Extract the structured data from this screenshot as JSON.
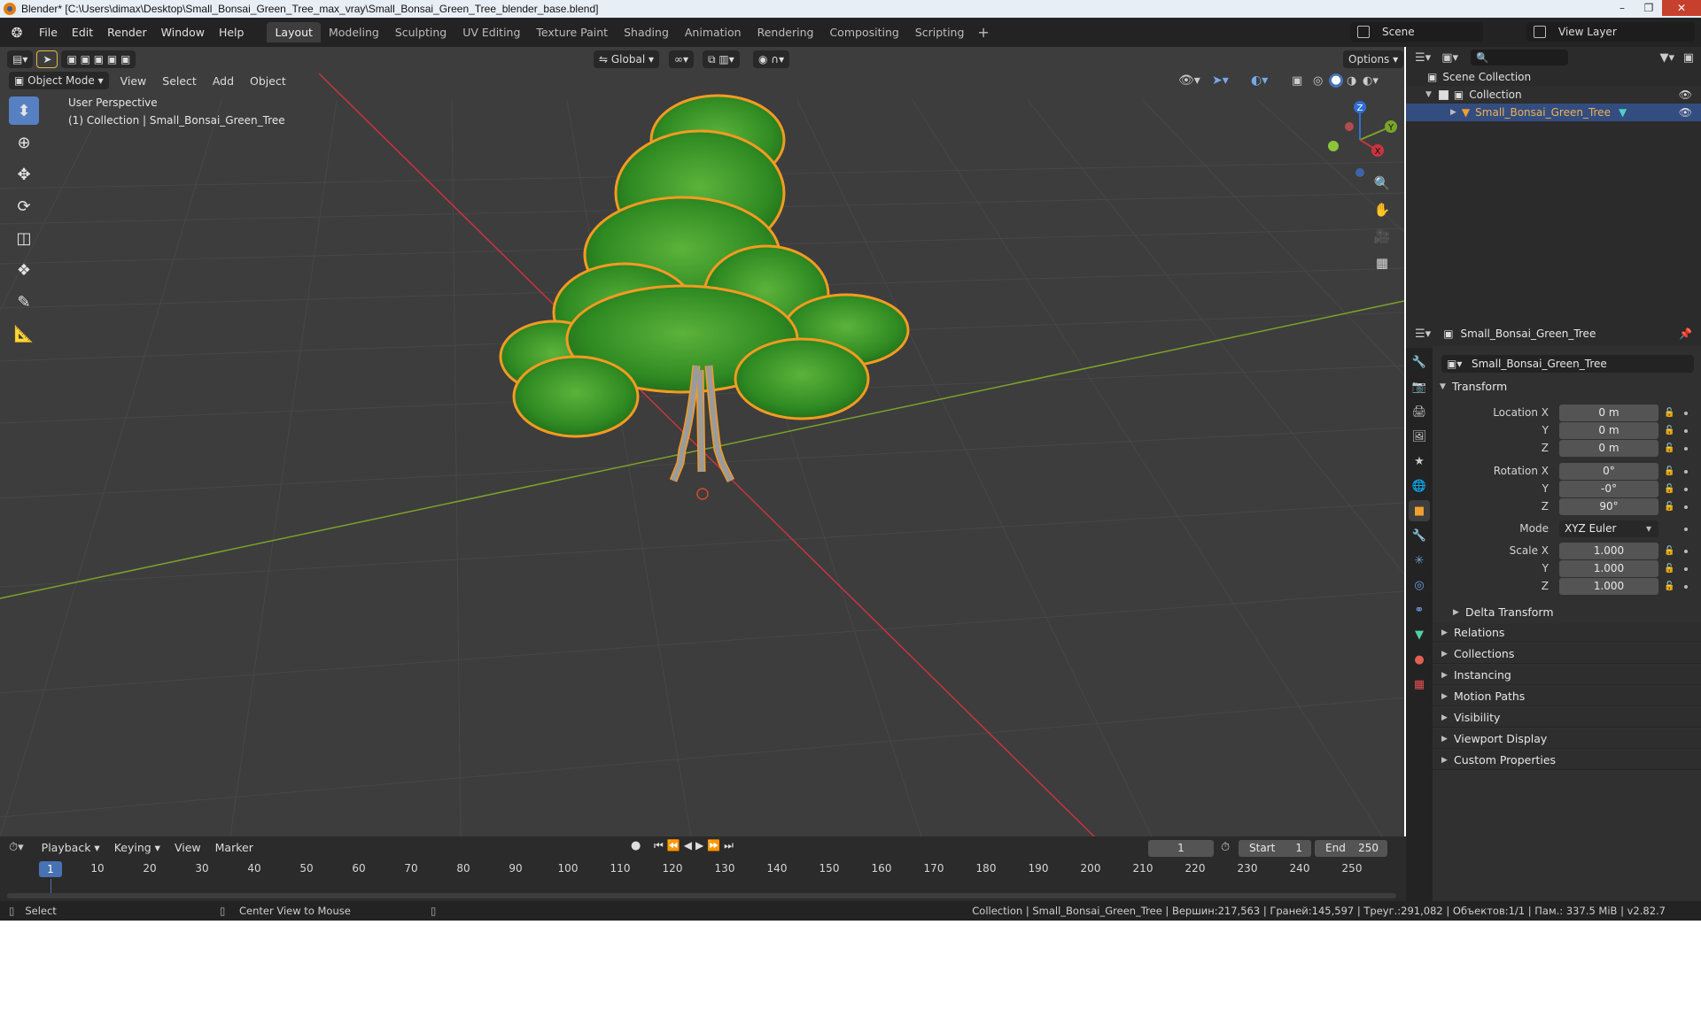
{
  "window": {
    "title": "Blender* [C:\\Users\\dimax\\Desktop\\Small_Bonsai_Green_Tree_max_vray\\Small_Bonsai_Green_Tree_blender_base.blend]"
  },
  "menus": [
    "File",
    "Edit",
    "Render",
    "Window",
    "Help"
  ],
  "workspaces": [
    "Layout",
    "Modeling",
    "Sculpting",
    "UV Editing",
    "Texture Paint",
    "Shading",
    "Animation",
    "Rendering",
    "Compositing",
    "Scripting"
  ],
  "active_workspace": "Layout",
  "scene": "Scene",
  "view_layer": "View Layer",
  "viewport": {
    "mode": "Object Mode",
    "menus": [
      "View",
      "Select",
      "Add",
      "Object"
    ],
    "orientation": "Global",
    "options_label": "Options",
    "perspective_label": "User Perspective",
    "collection_label": "(1) Collection | Small_Bonsai_Green_Tree",
    "gizmo_axes": {
      "x": "X",
      "y": "Y",
      "z": "Z"
    },
    "colors": {
      "background": "#3d3d3d",
      "x_axis": "#c9343f",
      "y_axis": "#7ba32a",
      "foliage": "#3a9a2b",
      "outline": "#f39b22"
    }
  },
  "outliner": {
    "root": "Scene Collection",
    "collection": "Collection",
    "object": "Small_Bonsai_Green_Tree"
  },
  "properties": {
    "header_object": "Small_Bonsai_Green_Tree",
    "object_name": "Small_Bonsai_Green_Tree",
    "transform_title": "Transform",
    "location_label": "Location X",
    "rotation_label": "Rotation X",
    "scale_label": "Scale X",
    "y_label": "Y",
    "z_label": "Z",
    "location": [
      "0 m",
      "0 m",
      "0 m"
    ],
    "rotation": [
      "0°",
      "-0°",
      "90°"
    ],
    "mode_label": "Mode",
    "mode_value": "XYZ Euler",
    "scale": [
      "1.000",
      "1.000",
      "1.000"
    ],
    "delta_transform": "Delta Transform",
    "collapsed_panels": [
      "Relations",
      "Collections",
      "Instancing",
      "Motion Paths",
      "Visibility",
      "Viewport Display",
      "Custom Properties"
    ]
  },
  "timeline": {
    "menus": [
      "Playback",
      "Keying",
      "View",
      "Marker"
    ],
    "current_frame": "1",
    "start_label": "Start",
    "start_value": "1",
    "end_label": "End",
    "end_value": "250",
    "ticks": [
      "10",
      "20",
      "30",
      "40",
      "50",
      "60",
      "70",
      "80",
      "90",
      "100",
      "110",
      "120",
      "130",
      "140",
      "150",
      "160",
      "170",
      "180",
      "190",
      "200",
      "210",
      "220",
      "230",
      "240",
      "250"
    ],
    "playhead": "1"
  },
  "statusbar": {
    "select": "Select",
    "center_view": "Center View to Mouse",
    "stats": "Collection | Small_Bonsai_Green_Tree | Вершин:217,563 | Граней:145,597 | Треуг.:291,082 | Объектов:1/1 | Пам.: 337.5 MiB | v2.82.7"
  }
}
